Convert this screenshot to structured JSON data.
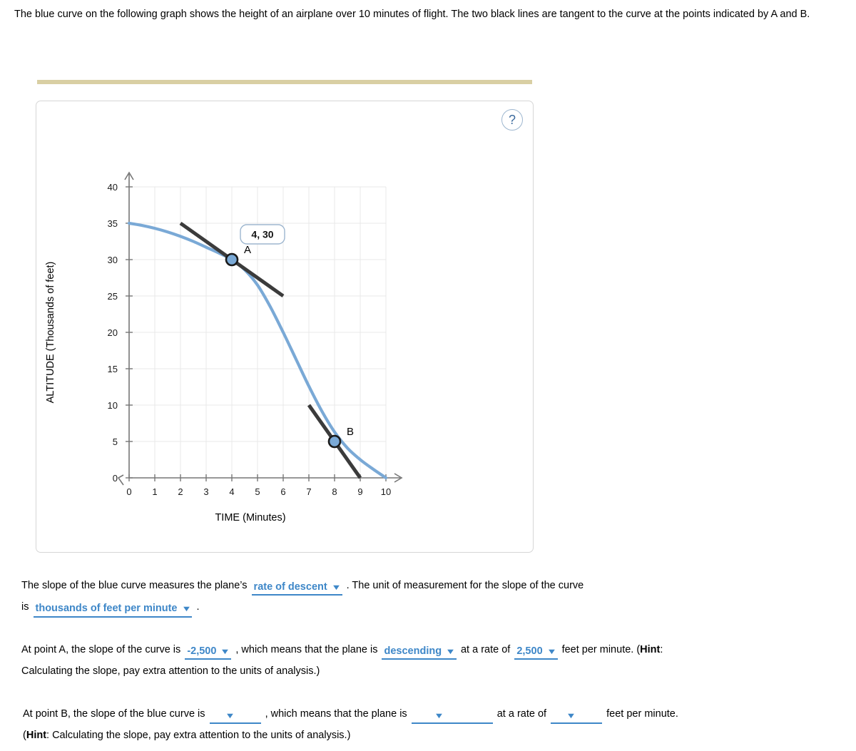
{
  "prompt": {
    "text": "The blue curve on the following graph shows the height of an airplane over 10 minutes of flight. The two black lines are tangent to the curve at the points indicated by A and B."
  },
  "panel": {
    "help_icon_label": "?"
  },
  "chart_data": {
    "type": "line",
    "title": "",
    "xlabel": "TIME (Minutes)",
    "ylabel": "ALTITUDE (Thousands of feet)",
    "xlim": [
      0,
      10
    ],
    "ylim": [
      0,
      40
    ],
    "xticks": [
      "0",
      "1",
      "2",
      "3",
      "4",
      "5",
      "6",
      "7",
      "8",
      "9",
      "10"
    ],
    "yticks": [
      "0",
      "5",
      "10",
      "15",
      "20",
      "25",
      "30",
      "35",
      "40"
    ],
    "grid": true,
    "legend": "none",
    "colors": {
      "curve": "#7aa9d6",
      "tangent": "#3b3b3b",
      "point_fill": "#7aa9d6",
      "point_stroke": "#1a1a1a",
      "grid": "#e8e8e8",
      "axis": "#767676"
    },
    "series": [
      {
        "name": "altitude curve",
        "x": [
          0,
          0.5,
          1,
          1.5,
          2,
          2.5,
          3,
          3.5,
          4,
          4.5,
          5,
          5.5,
          6,
          6.5,
          7,
          7.5,
          8,
          8.5,
          9,
          9.5,
          10
        ],
        "y": [
          35,
          34.7,
          34.3,
          33.8,
          33.2,
          32.5,
          31.7,
          30.9,
          30,
          28.6,
          26.5,
          23.5,
          20,
          16.3,
          12.6,
          9.2,
          6.3,
          4.1,
          2.5,
          1.2,
          0
        ]
      }
    ],
    "tangents": [
      {
        "name": "tangent-at-A",
        "x": [
          2,
          6
        ],
        "y": [
          35,
          25
        ],
        "slope": -2.5
      },
      {
        "name": "tangent-at-B",
        "x": [
          7,
          9
        ],
        "y": [
          10,
          0
        ],
        "slope": -5
      }
    ],
    "points": [
      {
        "label": "A",
        "x": 4,
        "y": 30,
        "tooltip": "4, 30"
      },
      {
        "label": "B",
        "x": 8,
        "y": 5,
        "tooltip": ""
      }
    ],
    "annotations": [
      {
        "name": "coordinate-tooltip",
        "text": "4, 30"
      },
      {
        "name": "point-label-a",
        "text": "A"
      },
      {
        "name": "point-label-b",
        "text": "B"
      }
    ]
  },
  "statement1": {
    "part_a": "The slope of the blue curve measures the plane’s",
    "dropdown1": "rate of descent",
    "part_b": ". The unit of measurement for the slope of the curve",
    "part_c": "is",
    "dropdown2": "thousands of feet per minute",
    "part_d": "."
  },
  "statement2": {
    "part_a": "At point A, the slope of the curve is",
    "dropdown1": "-2,500",
    "part_b": ", which means that the plane is",
    "dropdown2": "descending",
    "part_c": "at a rate of",
    "dropdown3": "2,500",
    "part_d": "feet per minute. (",
    "hint_word": "Hint",
    "part_e": ":",
    "part_f": "Calculating the slope, pay extra attention to the units of analysis.)"
  },
  "statement3": {
    "part_a": "At point B, the slope of the blue curve is",
    "dropdown1": "",
    "part_b": ", which means that the plane is",
    "dropdown2": "",
    "part_c": "at a rate of",
    "dropdown3": "",
    "part_d": "feet per minute.",
    "hint_open": "(",
    "hint_word": "Hint",
    "part_e": ": Calculating the slope, pay extra attention to the units of analysis.)"
  },
  "caret_glyph": "▼"
}
